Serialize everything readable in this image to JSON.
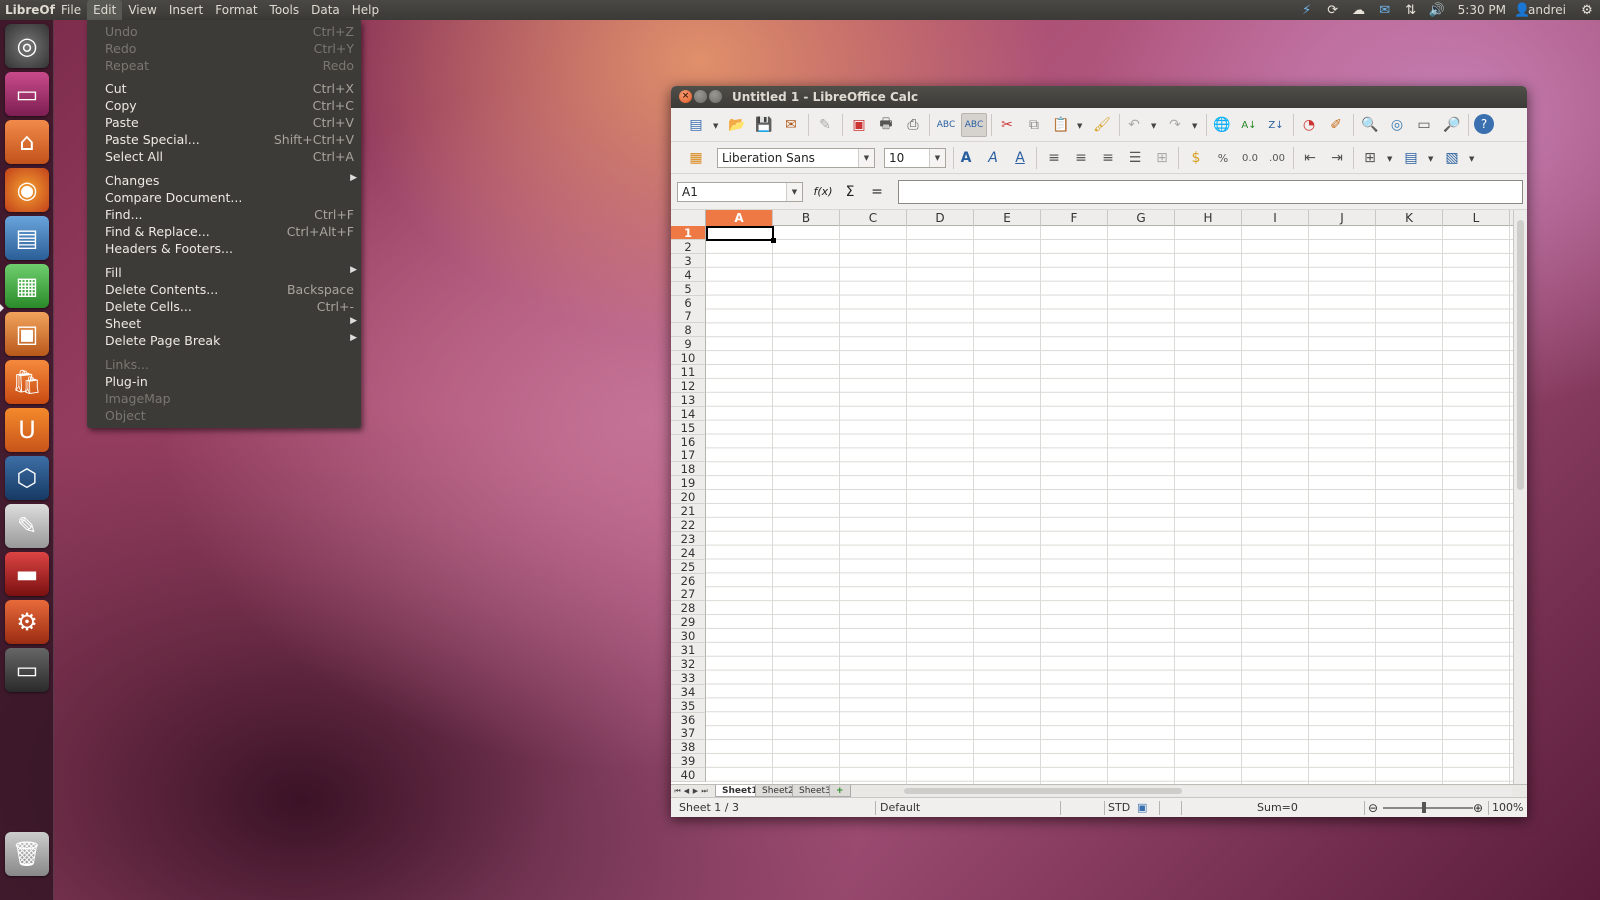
{
  "top_panel": {
    "app_name": "LibreOffice Calc",
    "menus": [
      "File",
      "Edit",
      "View",
      "Insert",
      "Format",
      "Tools",
      "Data",
      "Help"
    ],
    "clock": "5:30 PM",
    "user": "andrei"
  },
  "edit_menu": {
    "items": [
      {
        "label": "Undo",
        "shortcut": "Ctrl+Z",
        "disabled": true
      },
      {
        "label": "Redo",
        "shortcut": "Ctrl+Y",
        "disabled": true
      },
      {
        "label": "Repeat",
        "shortcut": "Redo",
        "disabled": true
      },
      {
        "label": "Cut",
        "shortcut": "Ctrl+X"
      },
      {
        "label": "Copy",
        "shortcut": "Ctrl+C"
      },
      {
        "label": "Paste",
        "shortcut": "Ctrl+V"
      },
      {
        "label": "Paste Special...",
        "shortcut": "Shift+Ctrl+V"
      },
      {
        "label": "Select All",
        "shortcut": "Ctrl+A"
      },
      {
        "label": "Changes",
        "shortcut": "",
        "submenu": true
      },
      {
        "label": "Compare Document...",
        "shortcut": ""
      },
      {
        "label": "Find...",
        "shortcut": "Ctrl+F"
      },
      {
        "label": "Find & Replace...",
        "shortcut": "Ctrl+Alt+F"
      },
      {
        "label": "Headers & Footers...",
        "shortcut": ""
      },
      {
        "label": "Fill",
        "shortcut": "",
        "submenu": true
      },
      {
        "label": "Delete Contents...",
        "shortcut": "Backspace"
      },
      {
        "label": "Delete Cells...",
        "shortcut": "Ctrl+-"
      },
      {
        "label": "Sheet",
        "shortcut": "",
        "submenu": true
      },
      {
        "label": "Delete Page Break",
        "shortcut": "",
        "submenu": true
      },
      {
        "label": "Links...",
        "shortcut": "",
        "disabled": true
      },
      {
        "label": "Plug-in",
        "shortcut": ""
      },
      {
        "label": "ImageMap",
        "shortcut": "",
        "disabled": true
      },
      {
        "label": "Object",
        "shortcut": "",
        "disabled": true
      }
    ]
  },
  "window": {
    "title": "Untitled 1 - LibreOffice Calc"
  },
  "format_toolbar": {
    "font_name": "Liberation Sans",
    "font_size": "10",
    "percent_label": "%"
  },
  "formula_bar": {
    "cell_ref": "A1",
    "fx_label": "f(x)",
    "sum_label": "Σ",
    "equals_label": "="
  },
  "grid": {
    "columns": [
      "A",
      "B",
      "C",
      "D",
      "E",
      "F",
      "G",
      "H",
      "I",
      "J",
      "K",
      "L"
    ],
    "rows": [
      "1",
      "2",
      "3",
      "4",
      "5",
      "6",
      "7",
      "8",
      "9",
      "10",
      "11",
      "12",
      "13",
      "14",
      "15",
      "16",
      "17",
      "18",
      "19",
      "20",
      "21",
      "22",
      "23",
      "24",
      "25",
      "26",
      "27",
      "28",
      "29",
      "30",
      "31",
      "32",
      "33",
      "34",
      "35",
      "36",
      "37",
      "38",
      "39",
      "40"
    ],
    "selected_col": "A",
    "selected_row": "1"
  },
  "sheets": {
    "tabs": [
      "Sheet1",
      "Sheet2",
      "Sheet3"
    ],
    "active": "Sheet1"
  },
  "status_bar": {
    "sheet": "Sheet 1 / 3",
    "page_style": "Default",
    "selection_mode": "STD",
    "sum": "Sum=0",
    "zoom": "100%"
  }
}
